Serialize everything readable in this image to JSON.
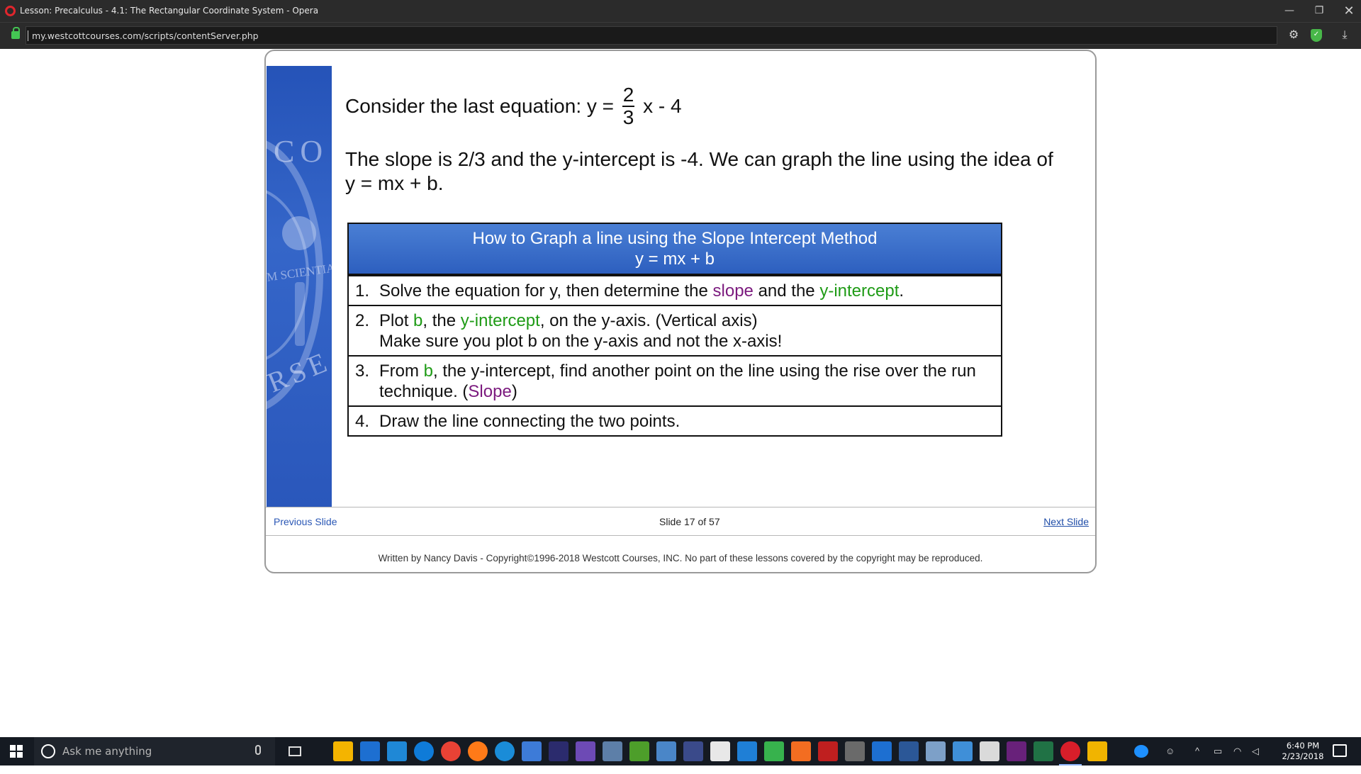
{
  "browser": {
    "window_title": "Lesson: Precalculus - 4.1: The Rectangular Coordinate System - Opera",
    "url": "my.westcottcourses.com/scripts/contentServer.php",
    "minimize_glyph": "—",
    "restore_glyph": "❐",
    "close_glyph": "✕",
    "settings_icon": "gear-icon",
    "download_icon": "download-icon"
  },
  "lesson": {
    "eq_prefix": "Consider the last equation:  y =",
    "frac_num": "2",
    "frac_den": "3",
    "eq_suffix": "x - 4",
    "paragraph_line1": "The slope is 2/3 and the y-intercept is -4.  We can graph the line using the idea of",
    "paragraph_line2": "y = mx + b.",
    "method_title": "How to Graph a line using the Slope Intercept Method",
    "method_formula": "y = mx + b",
    "steps": [
      {
        "n": "1.",
        "a": "Solve the equation for y, then determine the ",
        "slope": "slope",
        "and": " and the ",
        "yint": "y-intercept",
        "end": "."
      },
      {
        "n": "2.",
        "a": "Plot ",
        "b": "b",
        "c": ", the ",
        "yint": "y-intercept",
        "d": ", on the y-axis.  (Vertical axis)",
        "line2": "Make sure you plot b on the y-axis and not the x-axis!"
      },
      {
        "n": "3.",
        "a": "From ",
        "b": "b",
        "c": ", the y-intercept, find another point on the line using the rise over the run",
        "line2a": "technique.  (",
        "slope": "Slope",
        "line2b": ")"
      },
      {
        "n": "4.",
        "a": "Draw the line connecting the two points."
      }
    ],
    "seal_text_1": "CO",
    "seal_text_2": "M SCIENTIA",
    "seal_text_3": "RSE",
    "colors": {
      "slope": "#7b1a7e",
      "y_intercept": "#1f9b16",
      "header_blue": "#2d5fbf"
    }
  },
  "nav": {
    "previous": "Previous Slide",
    "slide_counter": "Slide 17 of 57",
    "next": "Next Slide"
  },
  "footer": "Written by Nancy Davis - Copyright©1996-2018 Westcott Courses, INC. No part of these lessons covered by the copyright may be reproduced.",
  "taskbar": {
    "search_placeholder": "Ask me anything",
    "time": "6:40 PM",
    "date": "2/23/2018"
  }
}
